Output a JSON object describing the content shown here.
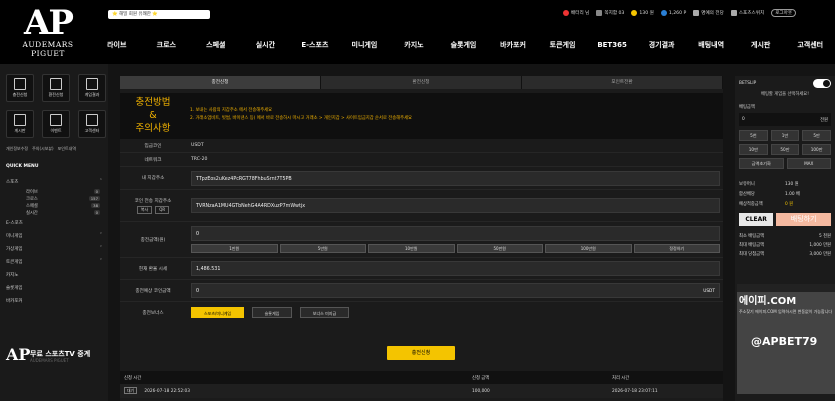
{
  "brand": {
    "logo_text": "AP",
    "logo_sub": "AUDEMARS PIGUET"
  },
  "notice": {
    "text": "⭐ 해밀 회원 유쾌한 ⭐"
  },
  "user": {
    "name": "배터리 님",
    "messages": "쪽지함 03",
    "points_gold": "130 원",
    "points_blue": "1,260 P",
    "items": [
      "명예의 전당",
      "스포츠스위치"
    ],
    "logout": "로그아웃"
  },
  "nav": [
    "라이브",
    "크로스",
    "스페셜",
    "실시간",
    "E-스포츠",
    "미니게임",
    "카지노",
    "슬롯게임",
    "바카포커",
    "토큰게임",
    "BET365",
    "경기결과",
    "배팅내역",
    "게시판",
    "고객센터"
  ],
  "sidebar": {
    "quick": [
      "충전신청",
      "환전신청",
      "게임결과",
      "게시판",
      "이벤트",
      "고객센터"
    ],
    "links": [
      "개인정보수정",
      "주의(시보뷰)",
      "포인트내역"
    ],
    "quick_label": "QUICK MENU",
    "menu": [
      {
        "label": "스포츠",
        "sub": [
          {
            "label": "라이브",
            "count": "0"
          },
          {
            "label": "크로스",
            "count": "157"
          },
          {
            "label": "스페셜",
            "count": "38"
          },
          {
            "label": "실시간",
            "count": "0"
          }
        ]
      },
      {
        "label": "E-스포츠"
      },
      {
        "label": "미니게임"
      },
      {
        "label": "가상게임"
      },
      {
        "label": "토큰게임"
      },
      {
        "label": "카지노"
      },
      {
        "label": "슬롯게임"
      },
      {
        "label": "바카포커"
      }
    ],
    "footer_logo": "AP",
    "footer_title": "무료 스포츠TV 중계",
    "footer_sub": "AUDEMARS PIGUET"
  },
  "main": {
    "tabs": [
      "충전신청",
      "환전신청",
      "포인트전환"
    ],
    "info_title": [
      "충전방법",
      "&",
      "주의사항"
    ],
    "info_lines": [
      "1. 보내는 사람의 지갑주소 에서 전송해주세요",
      "2. 거래소업비트, 빗썸, 바이낸스 등) 에서 바로 전송하시 마시고 거래소 > 개인지갑 > 사이트입금지갑 순서로 전송해주세요"
    ],
    "fields": {
      "coin_label": "입금코인",
      "coin": "USDT",
      "network_label": "네트워크",
      "network": "TRC-20",
      "my_wallet_label": "내 지갑주소",
      "my_wallet": "TTpzEos2uKez4PcRGT78FhbuSrnt7T5PB",
      "deposit_wallet_label": "코인 전송 지갑주소",
      "copy_btn": "복사",
      "qr_btn": "QR",
      "deposit_wallet": "TVRNzaA1MU4GTbNehG4A4RDXuzP7mWwtjx",
      "amount_label": "충전금액(원)",
      "amount": "0",
      "amount_buttons": [
        "1만원",
        "5만원",
        "10만원",
        "50만원",
        "100만원",
        "정정하기"
      ],
      "rate_label": "현재 환율 시세",
      "rate": "1,486.531",
      "coin_amount_label": "충전예상 코인금액",
      "coin_amount": "0",
      "coin_unit": "USDT",
      "bonus_label": "충전보너스",
      "bonus_options": [
        "스포츠/미니게임",
        "슬롯게임",
        "보너스 미지급"
      ]
    },
    "submit": "충전신청",
    "history": {
      "headers": [
        "신청 시간",
        "신청 금액",
        "처리 시간"
      ],
      "rows": [
        {
          "status": "대기",
          "time": "2026-07-18 22:52:03",
          "amount": "100,000",
          "processed": "2026-07-18 23:07:11"
        }
      ]
    }
  },
  "betslip": {
    "title": "BETSLIP",
    "desc": "배팅할 게임을 선택하세요!",
    "amount_label": "배팅금액",
    "amount": "0",
    "full": "전원",
    "chips": [
      "5천",
      "1만",
      "5만",
      "10만",
      "50만",
      "100만"
    ],
    "extra": [
      "금액초기화",
      "MAX"
    ],
    "held_label": "보유머니",
    "held": "130 원",
    "rate_label": "합산배당",
    "rate": "1.00 배",
    "expected_label": "예상적중금액",
    "expected": "0 원",
    "clear": "CLEAR",
    "bet": "배팅하기",
    "limits": [
      {
        "label": "최소 배팅금액",
        "value": "5 천원"
      },
      {
        "label": "최대 배팅금액",
        "value": "1,000 만원"
      },
      {
        "label": "최대 당첨금액",
        "value": "3,000 만원"
      }
    ],
    "ad_domain": "에이피.COM",
    "ad_sub": "주소찾기 에이피.COM 입력하시면 변동없이 가능합니다",
    "ad_handle": "@APBET79"
  },
  "colors": {
    "accent": "#f4c400",
    "info": "#f4b400"
  }
}
